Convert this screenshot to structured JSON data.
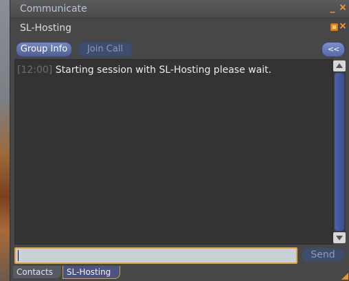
{
  "window": {
    "title": "Communicate",
    "minimize_symbol": "_",
    "close_symbol": "×"
  },
  "session": {
    "title": "SL-Hosting",
    "tab_icon": "session-tab-icon",
    "close_symbol": "×"
  },
  "toolbar": {
    "group_info_label": "Group Info",
    "join_call_label": "Join Call",
    "collapse_label": "<<"
  },
  "chat": {
    "lines": [
      {
        "timestamp": "[12:00]",
        "text": "Starting session with SL-Hosting please wait."
      }
    ]
  },
  "input": {
    "value": "",
    "placeholder": ""
  },
  "send_label": "Send",
  "tabs": [
    {
      "label": "Contacts"
    },
    {
      "label": "SL-Hosting"
    }
  ],
  "colors": {
    "accent": "#e8932a",
    "button_blue": "#556aa9",
    "timestamp": "#6d6d6d",
    "message": "#e8edf5"
  }
}
